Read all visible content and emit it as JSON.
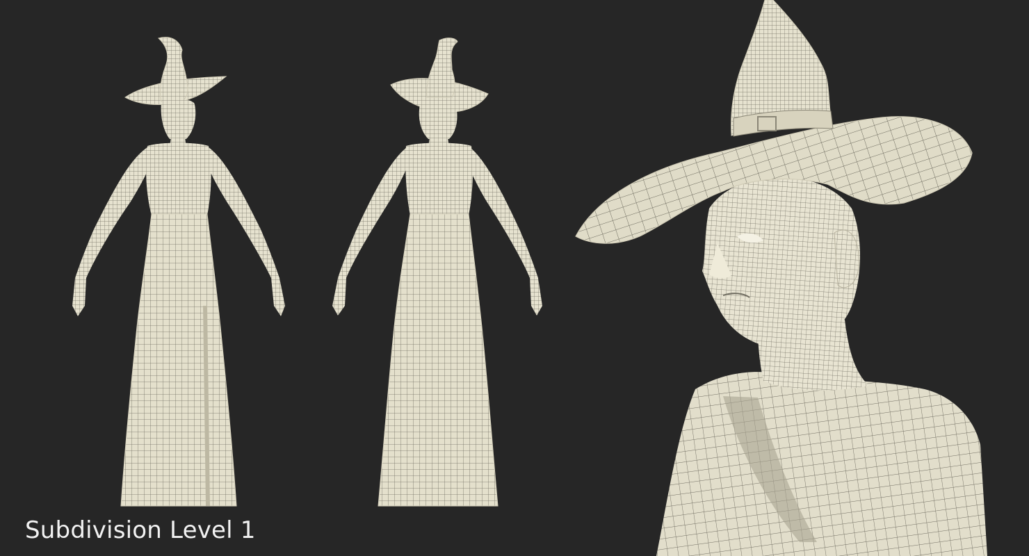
{
  "caption": "Subdivision Level 1",
  "colors": {
    "background": "#262626",
    "mesh_fill": "#e6e2cf",
    "mesh_line": "#6f6c60",
    "caption_text": "#f2f2f2"
  },
  "views": [
    {
      "name": "front-view"
    },
    {
      "name": "back-view"
    },
    {
      "name": "closeup-view"
    }
  ]
}
